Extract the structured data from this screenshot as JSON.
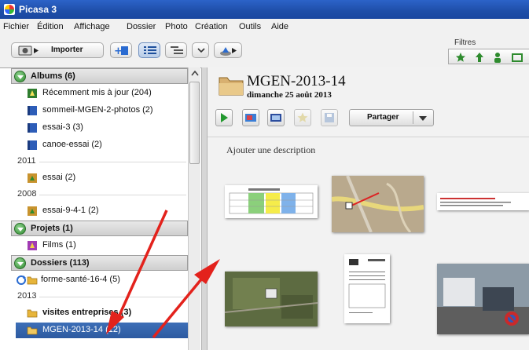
{
  "app": {
    "title": "Picasa 3"
  },
  "menu": [
    "Fichier",
    "Édition",
    "Affichage",
    "Dossier",
    "Photo",
    "Création",
    "Outils",
    "Aide"
  ],
  "toolbar": {
    "import_label": "Importer",
    "filters_label": "Filtres"
  },
  "sidebar": {
    "albums_header": "Albums (6)",
    "albums": [
      {
        "label": "Récemment mis à jour (204)",
        "icon": "recent-album-icon"
      },
      {
        "label": "sommeil-MGEN-2-photos (2)",
        "icon": "album-icon"
      },
      {
        "label": "essai-3 (3)",
        "icon": "album-icon"
      },
      {
        "label": "canoe-essai (2)",
        "icon": "album-icon"
      }
    ],
    "year_2011": "2011",
    "albums_2011": [
      {
        "label": "essai (2)",
        "icon": "album-icon"
      }
    ],
    "year_2008": "2008",
    "albums_2008": [
      {
        "label": "essai-9-4-1 (2)",
        "icon": "album-icon"
      }
    ],
    "projects_header": "Projets (1)",
    "projects": [
      {
        "label": "Films (1)",
        "icon": "film-project-icon"
      }
    ],
    "folders_header": "Dossiers (113)",
    "folders_top": [
      {
        "label": "forme-santé-16-4 (5)",
        "icon": "synced-folder-icon"
      }
    ],
    "year_2013": "2013",
    "folders_2013": [
      {
        "label": "visites entreprises (3)",
        "icon": "folder-icon"
      },
      {
        "label": "MGEN-2013-14 (12)",
        "icon": "folder-icon"
      }
    ]
  },
  "main": {
    "folder_title": "MGEN-2013-14",
    "folder_date": "dimanche 25 août 2013",
    "share_label": "Partager",
    "add_description": "Ajouter une description"
  },
  "colors": {
    "titlebar": "#2258b8",
    "selection": "#3465ad",
    "arrow": "#e3221c"
  }
}
